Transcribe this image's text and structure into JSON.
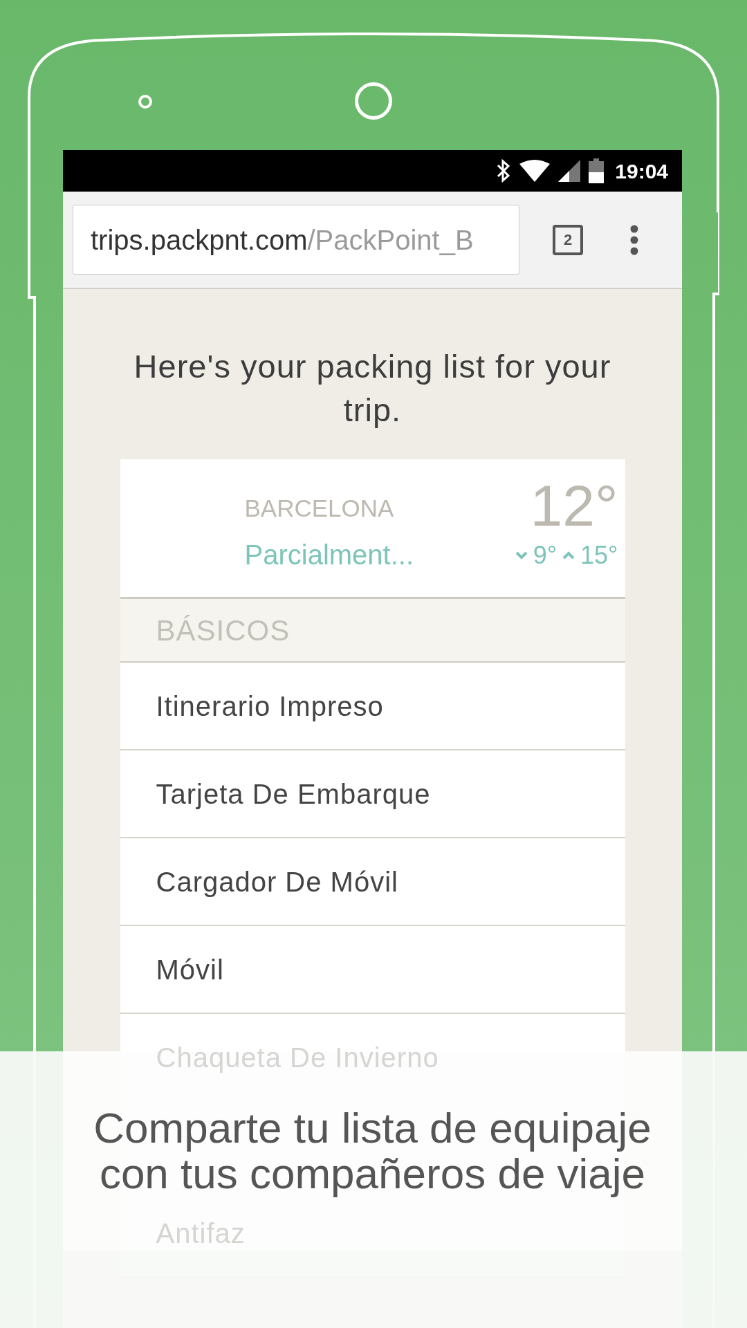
{
  "status_bar": {
    "time": "19:04"
  },
  "browser": {
    "url_host": "trips.packpnt.com",
    "url_path": "/PackPoint_B",
    "tab_count": "2"
  },
  "heading": "Here's your packing list for your trip.",
  "weather": {
    "city": "BARCELONA",
    "condition": "Parcialment...",
    "temperature": "12°",
    "low": "9°",
    "high": "15°"
  },
  "section": {
    "title": "BÁSICOS",
    "items": [
      "Itinerario Impreso",
      "Tarjeta De Embarque",
      "Cargador De Móvil",
      "Móvil"
    ]
  },
  "faded_items": [
    "Chaqueta De Invierno",
    "Antifaz"
  ],
  "caption": [
    "Comparte tu lista de equipaje",
    "con tus compañeros de viaje"
  ]
}
